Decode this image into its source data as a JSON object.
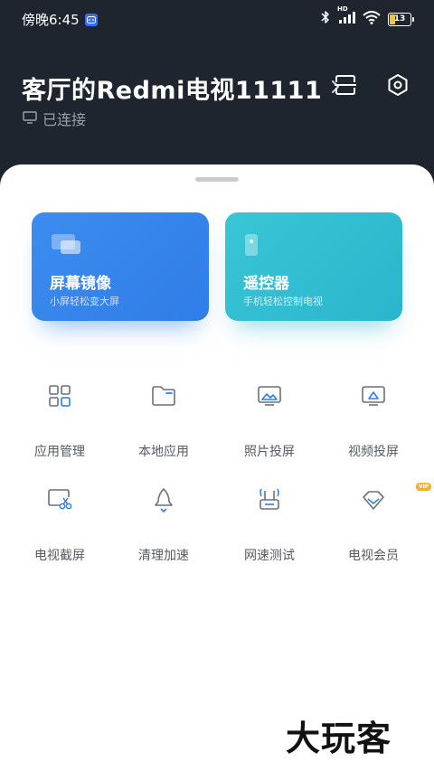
{
  "status_bar": {
    "time": "傍晚6:45",
    "battery": "13",
    "network_hd": "HD"
  },
  "header": {
    "device_name": "客厅的Redmi电视11111",
    "connection_status": "已连接"
  },
  "cards": [
    {
      "title": "屏幕镜像",
      "subtitle": "小屏轻松变大屏"
    },
    {
      "title": "遥控器",
      "subtitle": "手机轻松控制电视"
    }
  ],
  "grid": [
    {
      "label": "应用管理",
      "icon": "apps-grid-icon"
    },
    {
      "label": "本地应用",
      "icon": "folder-icon"
    },
    {
      "label": "照片投屏",
      "icon": "photo-cast-icon"
    },
    {
      "label": "视频投屏",
      "icon": "video-cast-icon"
    },
    {
      "label": "电视截屏",
      "icon": "screenshot-icon"
    },
    {
      "label": "清理加速",
      "icon": "rocket-icon"
    },
    {
      "label": "网速测试",
      "icon": "router-icon"
    },
    {
      "label": "电视会员",
      "icon": "vip-diamond-icon"
    }
  ],
  "vip_badge": "VIP",
  "watermark": "大玩客",
  "colors": {
    "header_bg": "#1f252e",
    "mirror_card": "#3c8cf0",
    "remote_card": "#2bb5cd",
    "icon_blue": "#2f7de6"
  }
}
